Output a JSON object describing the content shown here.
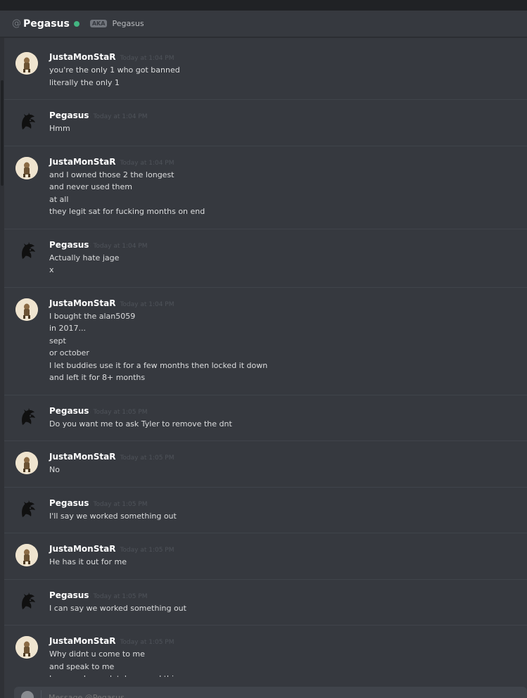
{
  "header": {
    "at_symbol": "@",
    "channel_name": "Pegasus",
    "aka_badge": "AKA",
    "aka_name": "Pegasus",
    "status_color": "#43b581"
  },
  "messages": [
    {
      "author": "JustaMonStaR",
      "avatar": "justamonstar-avatar",
      "time": "Today at 1:04 PM",
      "lines": [
        "you're the only 1 who got banned",
        "literally the only 1"
      ]
    },
    {
      "author": "Pegasus",
      "avatar": "pegasus-avatar",
      "time": "Today at 1:04 PM",
      "lines": [
        "Hmm"
      ]
    },
    {
      "author": "JustaMonStaR",
      "avatar": "justamonstar-avatar",
      "time": "Today at 1:04 PM",
      "lines": [
        "and I owned those 2 the longest",
        "and never used them",
        "at all",
        "they legit sat for fucking months on end"
      ]
    },
    {
      "author": "Pegasus",
      "avatar": "pegasus-avatar",
      "time": "Today at 1:04 PM",
      "lines": [
        "Actually hate jage",
        "x"
      ]
    },
    {
      "author": "JustaMonStaR",
      "avatar": "justamonstar-avatar",
      "time": "Today at 1:04 PM",
      "lines": [
        "I bought the alan5059",
        "in 2017...",
        "sept",
        "or october",
        "I let buddies use it for a few months then locked it down",
        "and left it for 8+ months"
      ]
    },
    {
      "author": "Pegasus",
      "avatar": "pegasus-avatar",
      "time": "Today at 1:05 PM",
      "lines": [
        "Do you want me to ask Tyler to remove the dnt"
      ]
    },
    {
      "author": "JustaMonStaR",
      "avatar": "justamonstar-avatar",
      "time": "Today at 1:05 PM",
      "lines": [
        "No"
      ]
    },
    {
      "author": "Pegasus",
      "avatar": "pegasus-avatar",
      "time": "Today at 1:05 PM",
      "lines": [
        "I'll say we worked something out"
      ]
    },
    {
      "author": "JustaMonStaR",
      "avatar": "justamonstar-avatar",
      "time": "Today at 1:05 PM",
      "lines": [
        "He has it out for me"
      ]
    },
    {
      "author": "Pegasus",
      "avatar": "pegasus-avatar",
      "time": "Today at 1:05 PM",
      "lines": [
        "I can say we worked something out"
      ]
    },
    {
      "author": "JustaMonStaR",
      "avatar": "justamonstar-avatar",
      "time": "Today at 1:05 PM",
      "lines": [
        "Why didnt u come to me",
        "and speak to me",
        "Im sorry I completely spaced this"
      ]
    }
  ],
  "composer": {
    "placeholder": "Message @Pegasus"
  }
}
